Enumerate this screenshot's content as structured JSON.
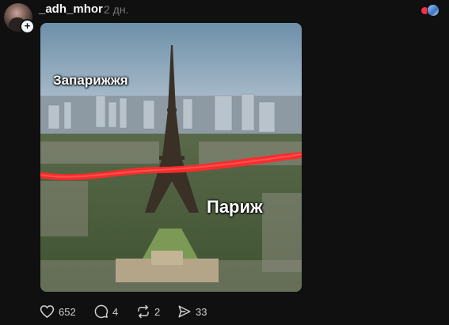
{
  "post": {
    "author": "_adh_mhor",
    "timestamp": "2 дн.",
    "image_labels": {
      "top_left": "Запарижжя",
      "center": "Париж"
    }
  },
  "actions": {
    "likes": "652",
    "replies": "4",
    "reposts": "2",
    "shares": "33"
  },
  "icons": {
    "like": "heart-icon",
    "reply": "comment-icon",
    "repost": "repost-icon",
    "share": "send-icon"
  },
  "colors": {
    "background": "#101010",
    "text": "#f3f5f7",
    "muted": "#777777",
    "annotation_line": "#ff2a2a"
  }
}
